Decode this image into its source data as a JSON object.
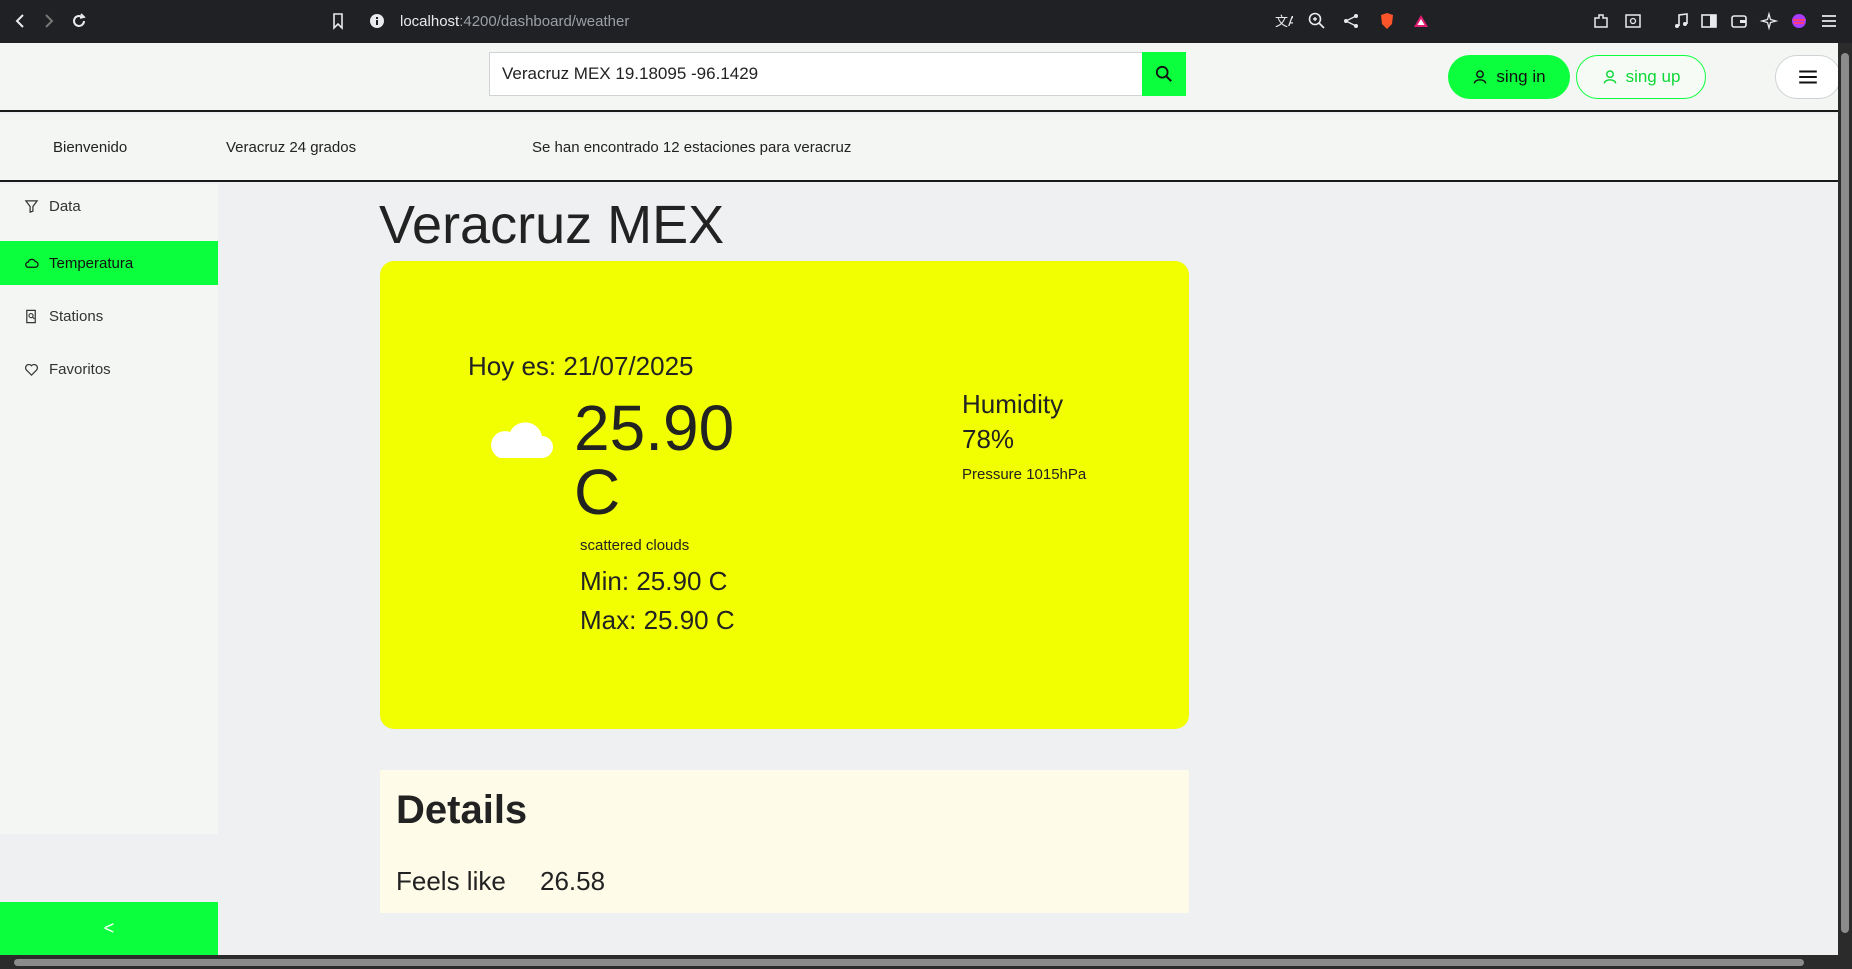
{
  "browser": {
    "url_host": "localhost",
    "url_path": ":4200/dashboard/weather"
  },
  "header": {
    "search_value": "Veracruz MEX 19.18095 -96.1429",
    "signin_label": "sing in",
    "signup_label": "sing up"
  },
  "info_bar": {
    "welcome": "Bienvenido",
    "temp_summary": "Veracruz 24 grados",
    "stations_found": "Se han encontrado 12 estaciones para veracruz"
  },
  "sidebar": {
    "items": [
      {
        "label": "Data",
        "icon": "filter-icon",
        "active": false
      },
      {
        "label": "Temperatura",
        "icon": "cloud-icon",
        "active": true
      },
      {
        "label": "Stations",
        "icon": "document-search-icon",
        "active": false
      },
      {
        "label": "Favoritos",
        "icon": "heart-icon",
        "active": false
      }
    ],
    "collapse_label": "<"
  },
  "main": {
    "title": "Veracruz MEX",
    "weather": {
      "date_line": "Hoy es: 21/07/2025",
      "temp_value": "25.90",
      "temp_unit": "C",
      "description": "scattered clouds",
      "min": "Min: 25.90 C",
      "max": "Max: 25.90 C",
      "humidity_label": "Humidity",
      "humidity_value": "78%",
      "pressure": "Pressure 1015hPa"
    },
    "details": {
      "title": "Details",
      "feels_like_label": "Feels like",
      "feels_like_value": "26.58"
    }
  },
  "colors": {
    "accent_green": "#0cff3c",
    "card_yellow": "#f1ff00",
    "details_bg": "#fefbe8"
  }
}
